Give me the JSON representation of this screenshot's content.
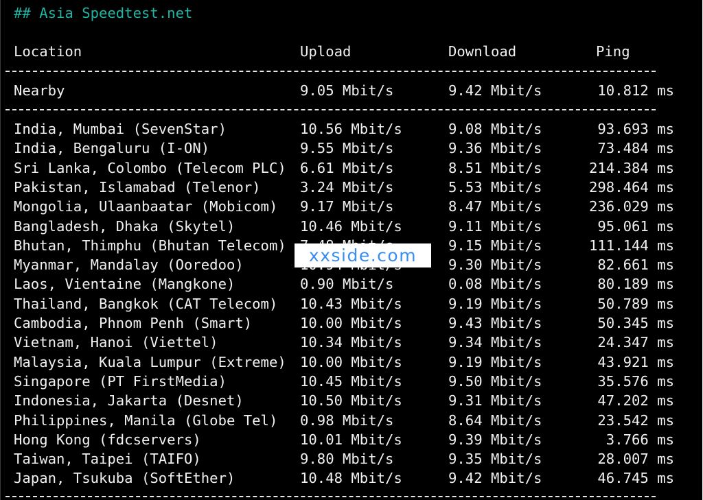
{
  "heading": "## Asia Speedtest.net",
  "columns": {
    "location": "Location",
    "upload": "Upload",
    "download": "Download",
    "ping": "Ping"
  },
  "nearby": {
    "location": "Nearby",
    "upload": "9.05 Mbit/s",
    "download": "9.42 Mbit/s",
    "ping": "10.812 ms"
  },
  "rows": [
    {
      "location": "India, Mumbai (SevenStar)",
      "upload": "10.56 Mbit/s",
      "download": "9.08 Mbit/s",
      "ping": "93.693 ms"
    },
    {
      "location": "India, Bengaluru (I-ON)",
      "upload": "9.55 Mbit/s",
      "download": "9.36 Mbit/s",
      "ping": "73.484 ms"
    },
    {
      "location": "Sri Lanka, Colombo (Telecom PLC)",
      "upload": "6.61 Mbit/s",
      "download": "8.51 Mbit/s",
      "ping": "214.384 ms"
    },
    {
      "location": "Pakistan, Islamabad (Telenor)",
      "upload": "3.24 Mbit/s",
      "download": "5.53 Mbit/s",
      "ping": "298.464 ms"
    },
    {
      "location": "Mongolia, Ulaanbaatar (Mobicom)",
      "upload": "9.17 Mbit/s",
      "download": "8.47 Mbit/s",
      "ping": "236.029 ms"
    },
    {
      "location": "Bangladesh, Dhaka (Skytel)",
      "upload": "10.46 Mbit/s",
      "download": "9.11 Mbit/s",
      "ping": "95.061 ms"
    },
    {
      "location": "Bhutan, Thimphu (Bhutan Telecom)",
      "upload": "7.48 Mbit/s",
      "download": "9.15 Mbit/s",
      "ping": "111.144 ms"
    },
    {
      "location": "Myanmar, Mandalay (Ooredoo)",
      "upload": "10.94 Mbit/s",
      "download": "9.30 Mbit/s",
      "ping": "82.661 ms"
    },
    {
      "location": "Laos, Vientaine (Mangkone)",
      "upload": "0.90 Mbit/s",
      "download": "0.08 Mbit/s",
      "ping": "80.189 ms"
    },
    {
      "location": "Thailand, Bangkok (CAT Telecom)",
      "upload": "10.43 Mbit/s",
      "download": "9.19 Mbit/s",
      "ping": "50.789 ms"
    },
    {
      "location": "Cambodia, Phnom Penh (Smart)",
      "upload": "10.00 Mbit/s",
      "download": "9.43 Mbit/s",
      "ping": "50.345 ms"
    },
    {
      "location": "Vietnam, Hanoi (Viettel)",
      "upload": "10.34 Mbit/s",
      "download": "9.34 Mbit/s",
      "ping": "24.347 ms"
    },
    {
      "location": "Malaysia, Kuala Lumpur (Extreme)",
      "upload": "10.00 Mbit/s",
      "download": "9.19 Mbit/s",
      "ping": "43.921 ms"
    },
    {
      "location": "Singapore (PT FirstMedia)",
      "upload": "10.45 Mbit/s",
      "download": "9.50 Mbit/s",
      "ping": "35.576 ms"
    },
    {
      "location": "Indonesia, Jakarta (Desnet)",
      "upload": "10.50 Mbit/s",
      "download": "9.31 Mbit/s",
      "ping": "47.202 ms"
    },
    {
      "location": "Philippines, Manila (Globe Tel)",
      "upload": "0.98 Mbit/s",
      "download": "8.64 Mbit/s",
      "ping": "23.542 ms"
    },
    {
      "location": "Hong Kong (fdcservers)",
      "upload": "10.01 Mbit/s",
      "download": "9.39 Mbit/s",
      "ping": "3.766 ms"
    },
    {
      "location": "Taiwan, Taipei (TAIFO)",
      "upload": "9.80 Mbit/s",
      "download": "9.35 Mbit/s",
      "ping": "28.007 ms"
    },
    {
      "location": "Japan, Tsukuba (SoftEther)",
      "upload": "10.48 Mbit/s",
      "download": "9.42 Mbit/s",
      "ping": "46.745 ms"
    }
  ],
  "watermark": "xxside.com",
  "colors": {
    "heading": "#1fb5a3",
    "text": "#f0f0f0",
    "background": "#000000",
    "watermark": "#3b8ef0"
  }
}
